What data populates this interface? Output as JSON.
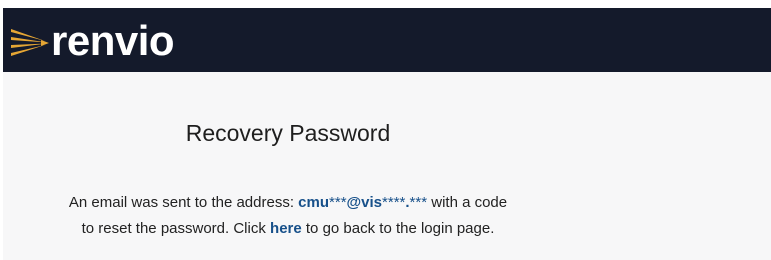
{
  "brand": {
    "name": "renvio",
    "mark_icon": "renvio-sunburst-icon",
    "colors": {
      "header_bg": "#141a2b",
      "mark": "#e6a634",
      "link": "#17508a"
    }
  },
  "main": {
    "title": "Recovery Password",
    "message": {
      "prefix": "An email was sent to the address:",
      "email_part1": "cmu",
      "email_mask1": "***",
      "email_part2": "@vis",
      "email_mask2": "****",
      "email_part3": ".",
      "email_mask3": "***",
      "line1_suffix": "with a code",
      "line2_prefix": "to reset the password. Click",
      "link_label": "here",
      "line2_suffix": "to go back to the login page."
    }
  }
}
